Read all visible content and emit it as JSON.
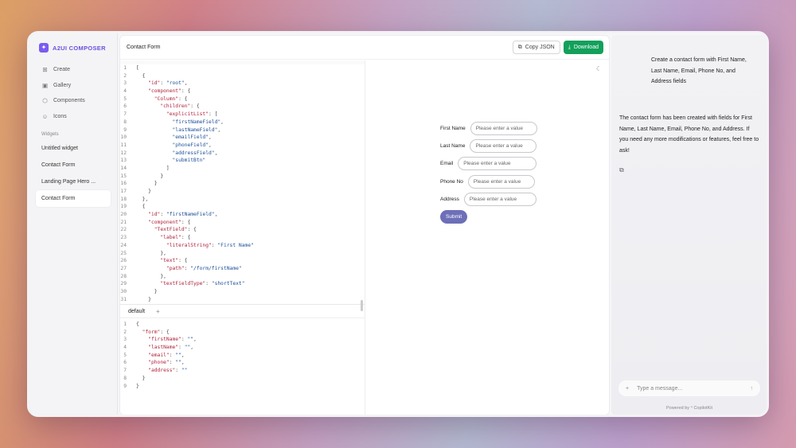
{
  "app": {
    "name": "A2UI COMPOSER"
  },
  "sidebar": {
    "nav": [
      {
        "label": "Create",
        "icon": "plus-square-icon"
      },
      {
        "label": "Gallery",
        "icon": "image-icon"
      },
      {
        "label": "Components",
        "icon": "box-icon"
      },
      {
        "label": "Icons",
        "icon": "smile-icon"
      }
    ],
    "section_label": "Widgets",
    "widgets": [
      "Untitled widget",
      "Contact Form",
      "Landing Page Hero ...",
      "Contact Form"
    ]
  },
  "main": {
    "title": "Contact Form",
    "copy_label": "Copy JSON",
    "download_label": "Download",
    "tab_label": "default",
    "tab_add": "+"
  },
  "code_top": [
    "[",
    "  {",
    "    \"id\": \"root\",",
    "    \"component\": {",
    "      \"Column\": {",
    "        \"children\": {",
    "          \"explicitList\": [",
    "            \"firstNameField\",",
    "            \"lastNameField\",",
    "            \"emailField\",",
    "            \"phoneField\",",
    "            \"addressField\",",
    "            \"submitBtn\"",
    "          ]",
    "        }",
    "      }",
    "    }",
    "  },",
    "  {",
    "    \"id\": \"firstNameField\",",
    "    \"component\": {",
    "      \"TextField\": {",
    "        \"label\": {",
    "          \"literalString\": \"First Name\"",
    "        },",
    "        \"text\": {",
    "          \"path\": \"/form/firstName\"",
    "        },",
    "        \"textFieldType\": \"shortText\"",
    "      }",
    "    }",
    "  }"
  ],
  "code_bottom": [
    "{",
    "  \"form\": {",
    "    \"firstName\": \"\",",
    "    \"lastName\": \"\",",
    "    \"email\": \"\",",
    "    \"phone\": \"\",",
    "    \"address\": \"\"",
    "  }",
    "}"
  ],
  "form": {
    "fields": [
      {
        "label": "First Name",
        "placeholder": "Please enter a value"
      },
      {
        "label": "Last Name",
        "placeholder": "Please enter a value"
      },
      {
        "label": "Email",
        "placeholder": "Please enter a value"
      },
      {
        "label": "Phone No",
        "placeholder": "Please enter a value"
      },
      {
        "label": "Address",
        "placeholder": "Please enter a value"
      }
    ],
    "submit_label": "Submit"
  },
  "chat": {
    "user_message": "Create a contact form with First Name, Last Name, Email, Phone No, and Address fields",
    "assistant_message": "The contact form has been created with fields for First Name, Last Name, Email, Phone No, and Address. If you need any more modifications or features, feel free to ask!",
    "input_placeholder": "Type a message...",
    "powered_by": "Powered by ⁴ CopilotKit"
  },
  "colors": {
    "brand": "#6b4fe0",
    "download": "#13a05a",
    "submit": "#6d6fb8"
  }
}
